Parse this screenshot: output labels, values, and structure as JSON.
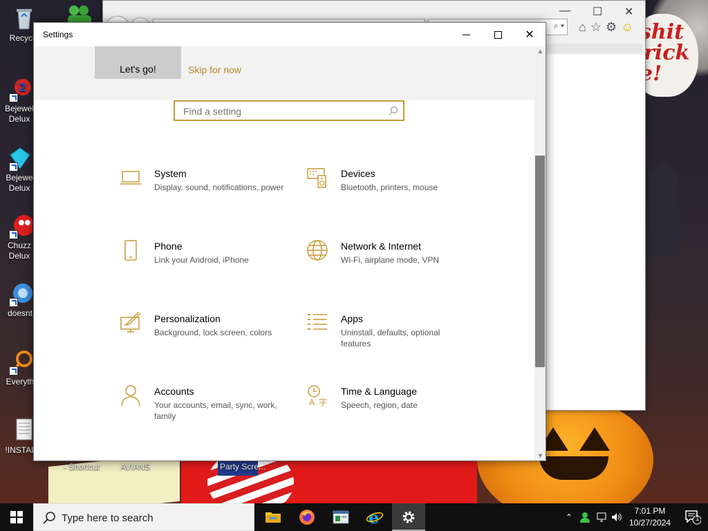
{
  "desktop": {
    "icons": [
      {
        "label": "Recycle",
        "name": "recycle-bin-icon"
      },
      {
        "label": "Bejewel Delux",
        "name": "bejeweled-icon"
      },
      {
        "label": "Bejewe Delux",
        "name": "bejeweled-2-icon"
      },
      {
        "label": "Chuzz Delux",
        "name": "chuzzle-icon"
      },
      {
        "label": "doesnt",
        "name": "doesnt-icon"
      },
      {
        "label": "Everyth",
        "name": "everything-search-icon"
      },
      {
        "label": "!INSTALL",
        "name": "install-file-icon"
      }
    ],
    "bottom_labels": [
      "- Shortcut",
      "AVIANS",
      "Party Scre..."
    ],
    "speech_text": [
      "shit",
      "rick",
      "e!"
    ]
  },
  "settings": {
    "title": "Settings",
    "banner": {
      "lets_go_label": "Let's go!",
      "skip_label": "Skip for now"
    },
    "search": {
      "placeholder": "Find a setting"
    },
    "tiles": [
      {
        "title": "System",
        "desc": "Display, sound, notifications, power",
        "icon": "laptop-icon"
      },
      {
        "title": "Devices",
        "desc": "Bluetooth, printers, mouse",
        "icon": "keyboard-speaker-icon"
      },
      {
        "title": "Phone",
        "desc": "Link your Android, iPhone",
        "icon": "phone-icon"
      },
      {
        "title": "Network & Internet",
        "desc": "Wi-Fi, airplane mode, VPN",
        "icon": "globe-icon"
      },
      {
        "title": "Personalization",
        "desc": "Background, lock screen, colors",
        "icon": "paint-brush-icon"
      },
      {
        "title": "Apps",
        "desc": "Uninstall, defaults, optional features",
        "icon": "apps-list-icon"
      },
      {
        "title": "Accounts",
        "desc": "Your accounts, email, sync, work, family",
        "icon": "person-icon"
      },
      {
        "title": "Time & Language",
        "desc": "Speech, region, date",
        "icon": "time-language-icon"
      }
    ],
    "accent_color": "#c99a36"
  },
  "taskbar": {
    "search_placeholder": "Type here to search",
    "time": "7:01 PM",
    "date": "10/27/2024",
    "notification_count": "1",
    "apps": [
      "file-explorer-icon",
      "firefox-icon",
      "window-app-icon",
      "internet-explorer-icon",
      "settings-gear-icon"
    ]
  }
}
